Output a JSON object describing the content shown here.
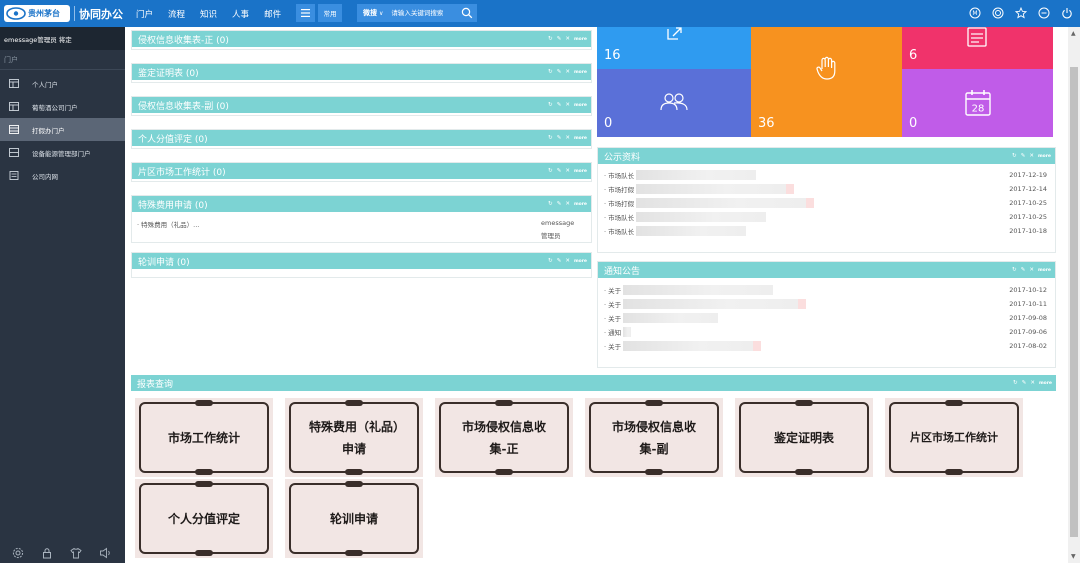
{
  "app": {
    "logo_text": "贵州茅台",
    "title": "协同办公"
  },
  "nav": {
    "items": [
      "门户",
      "流程",
      "知识",
      "人事",
      "邮件"
    ],
    "common_label": "常用",
    "search_category": "微搜",
    "search_placeholder": "请输入关键词搜索"
  },
  "sidebar": {
    "user": "emessage管理员 将定",
    "section": "门户",
    "items": [
      {
        "label": "个人门户"
      },
      {
        "label": "葡萄酒公司门户"
      },
      {
        "label": "打假办门户"
      },
      {
        "label": "设备能源管理部门户"
      },
      {
        "label": "公司内网"
      }
    ]
  },
  "widgets": {
    "w1": {
      "title": "侵权信息收集表-正 (0)"
    },
    "w2": {
      "title": "鉴定证明表 (0)"
    },
    "w3": {
      "title": "侵权信息收集表-副 (0)"
    },
    "w4": {
      "title": "个人分值评定 (0)"
    },
    "w5": {
      "title": "片区市场工作统计 (0)"
    },
    "w6": {
      "title": "特殊费用申请 (0)",
      "row_text": "· 特殊费用（礼品）...",
      "row_user_1": "emessage",
      "row_user_2": "管理员"
    },
    "w7": {
      "title": "轮训申请 (0)"
    },
    "more_label": "more"
  },
  "tiles": {
    "t1": {
      "count": "16",
      "color": "#2f9bf0"
    },
    "t2": {
      "count": "6",
      "color": "#f0336b"
    },
    "t3": {
      "count": "0",
      "color": "#5a70d8"
    },
    "t4": {
      "count": "36",
      "color": "#f7921f"
    },
    "t5": {
      "count": "0",
      "color": "#c05ce8"
    },
    "t5_calendar_day": "28"
  },
  "public_docs": {
    "title": "公示资料",
    "rows": [
      {
        "title": "· 市场队长",
        "date": "2017-12-19"
      },
      {
        "title": "· 市场打假",
        "date": "2017-12-14"
      },
      {
        "title": "· 市场打假",
        "date": "2017-10-25"
      },
      {
        "title": "· 市场队长",
        "date": "2017-10-25"
      },
      {
        "title": "· 市场队长",
        "date": "2017-10-18"
      }
    ]
  },
  "notices": {
    "title": "通知公告",
    "rows": [
      {
        "title": "· 关于",
        "date": "2017-10-12"
      },
      {
        "title": "· 关于",
        "date": "2017-10-11"
      },
      {
        "title": "· 关于",
        "date": "2017-09-08"
      },
      {
        "title": "· 通知",
        "date": "2017-09-06"
      },
      {
        "title": "· 关于",
        "date": "2017-08-02"
      }
    ]
  },
  "reports": {
    "title": "报表查询",
    "cards": [
      {
        "label": "市场工作统计"
      },
      {
        "label": "特殊费用（礼品）申请"
      },
      {
        "label": "市场侵权信息收集-正"
      },
      {
        "label": "市场侵权信息收集-副"
      },
      {
        "label": "鉴定证明表"
      },
      {
        "label": "片区市场工作统计"
      },
      {
        "label": "个人分值评定"
      },
      {
        "label": "轮训申请"
      }
    ]
  }
}
